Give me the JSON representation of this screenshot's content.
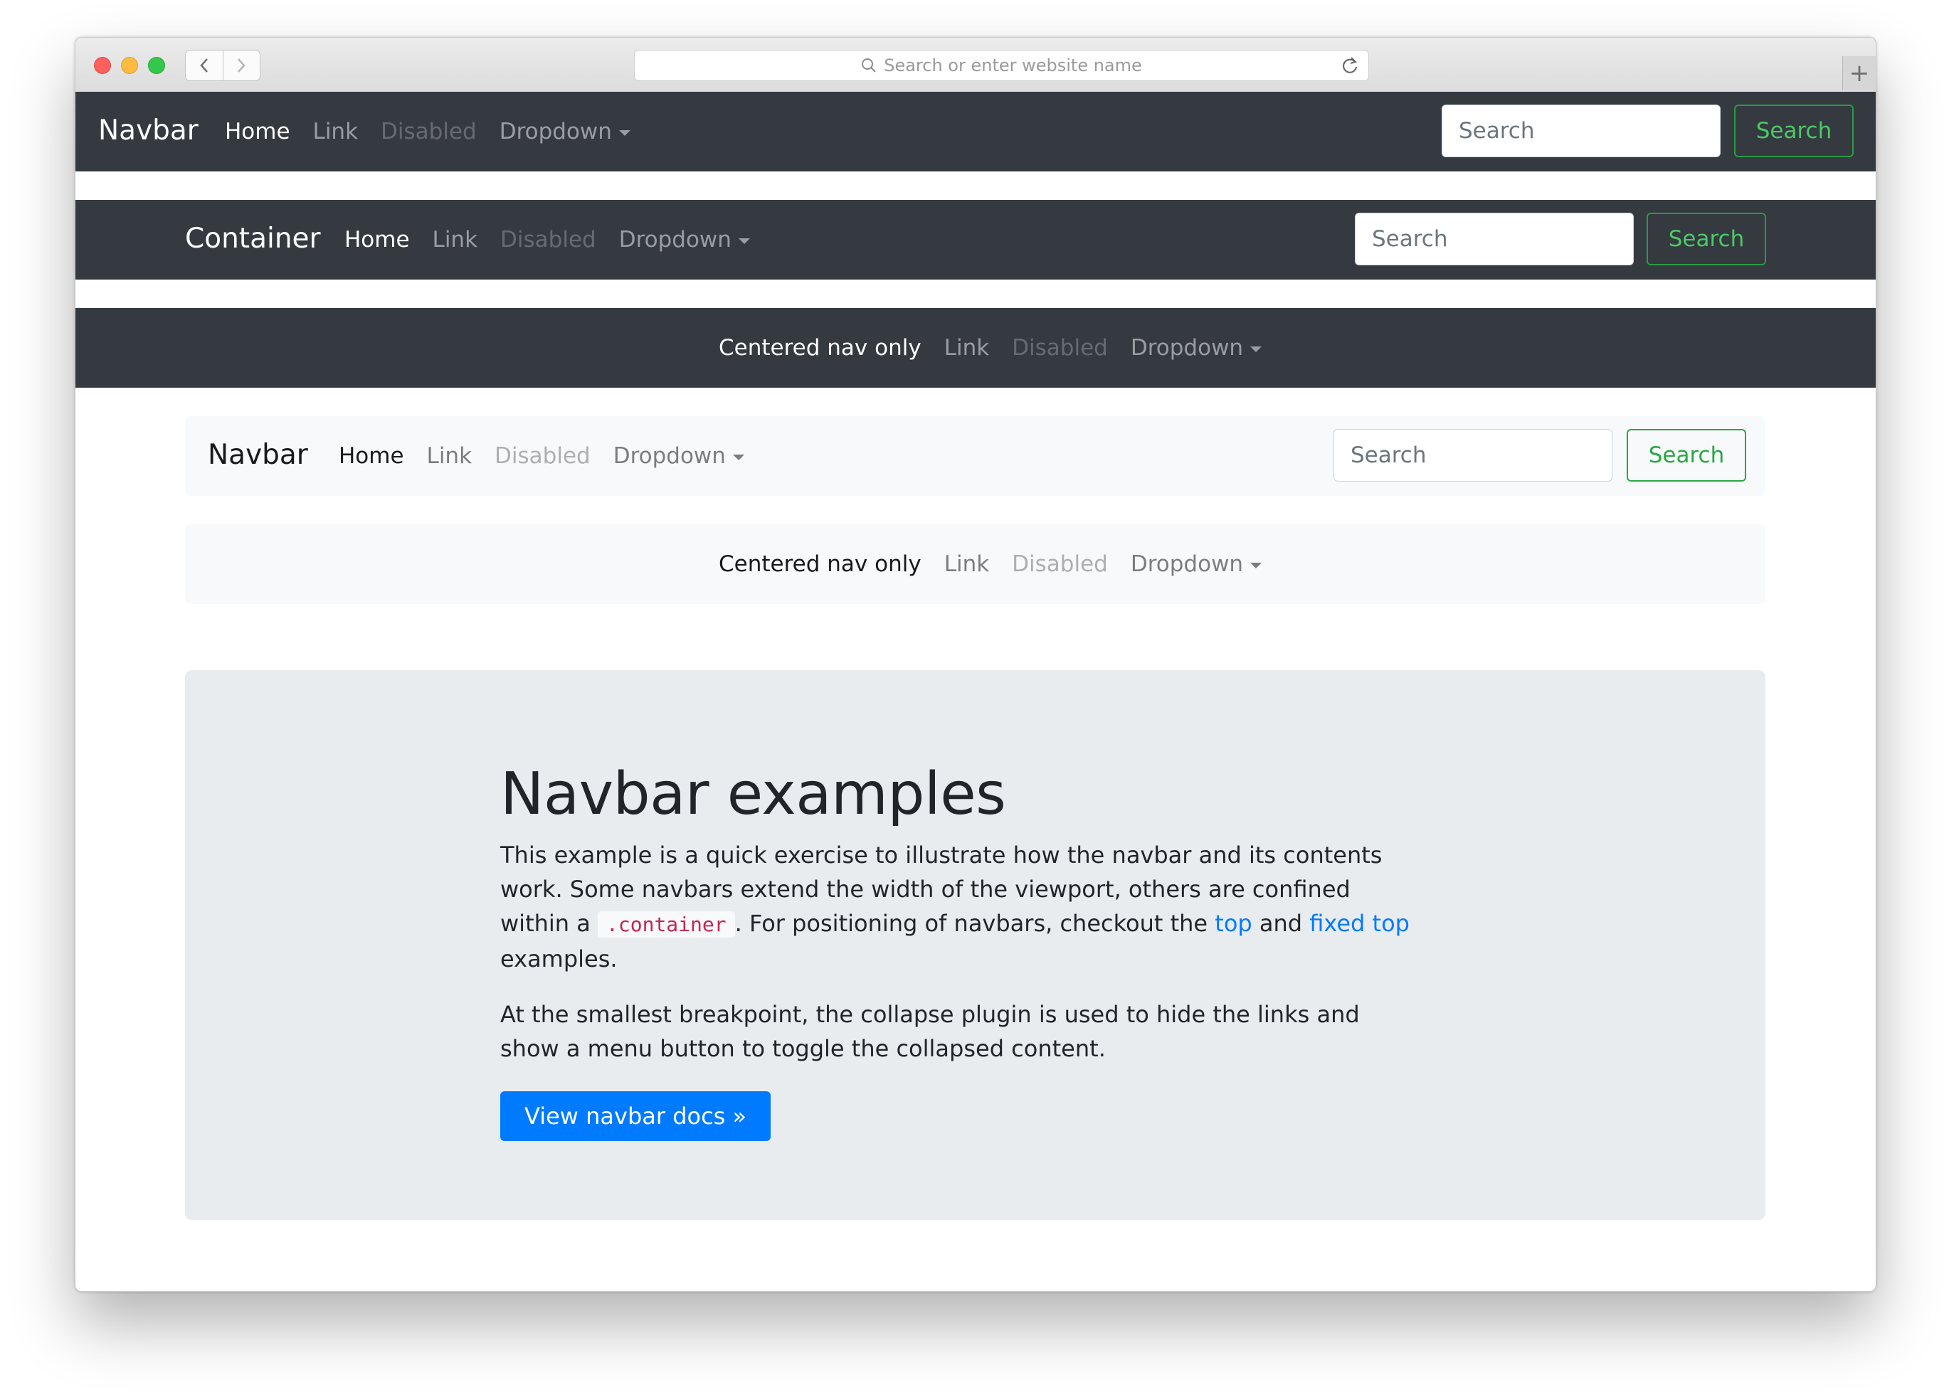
{
  "browser": {
    "address_placeholder": "Search or enter website name",
    "new_tab": "+"
  },
  "navbar1": {
    "brand": "Navbar",
    "links": [
      "Home",
      "Link",
      "Disabled",
      "Dropdown"
    ],
    "search_placeholder": "Search",
    "search_button": "Search"
  },
  "navbar2": {
    "brand": "Container",
    "links": [
      "Home",
      "Link",
      "Disabled",
      "Dropdown"
    ],
    "search_placeholder": "Search",
    "search_button": "Search"
  },
  "navbar3": {
    "links": [
      "Centered nav only",
      "Link",
      "Disabled",
      "Dropdown"
    ]
  },
  "navbar4": {
    "brand": "Navbar",
    "links": [
      "Home",
      "Link",
      "Disabled",
      "Dropdown"
    ],
    "search_placeholder": "Search",
    "search_button": "Search"
  },
  "navbar5": {
    "links": [
      "Centered nav only",
      "Link",
      "Disabled",
      "Dropdown"
    ]
  },
  "jumbotron": {
    "title": "Navbar examples",
    "p1_a": "This example is a quick exercise to illustrate how the navbar and its contents work. Some navbars extend the width of the viewport, others are confined within a ",
    "p1_code": ".container",
    "p1_b": ". For positioning of navbars, checkout the ",
    "p1_link1": "top",
    "p1_c": " and ",
    "p1_link2": "fixed top",
    "p1_d": " examples.",
    "p2": "At the smallest breakpoint, the collapse plugin is used to hide the links and show a menu button to toggle the collapsed content.",
    "button": "View navbar docs »"
  },
  "colors": {
    "dark_navbar": "#343a40",
    "light_navbar": "#f8f9fa",
    "success": "#28a745",
    "primary": "#007bff",
    "jumbotron_bg": "#e9ecef"
  }
}
